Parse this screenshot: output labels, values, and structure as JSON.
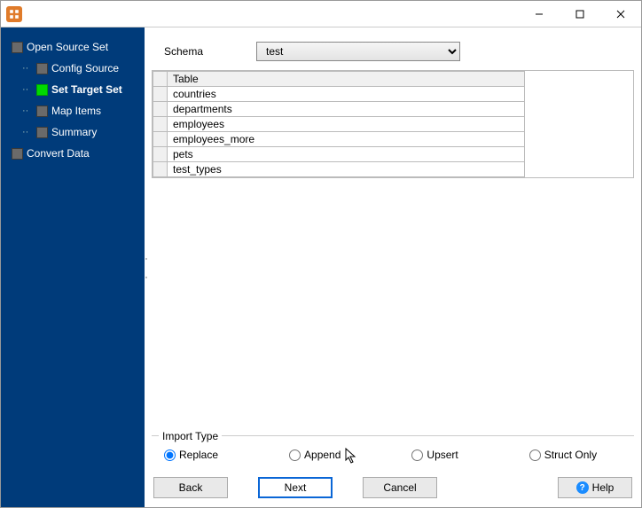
{
  "sidebar": {
    "items": [
      {
        "label": "Open Source Set",
        "depth": 0,
        "active": false
      },
      {
        "label": "Config Source",
        "depth": 1,
        "active": false
      },
      {
        "label": "Set Target Set",
        "depth": 1,
        "active": true
      },
      {
        "label": "Map Items",
        "depth": 1,
        "active": false
      },
      {
        "label": "Summary",
        "depth": 1,
        "active": false
      },
      {
        "label": "Convert Data",
        "depth": 0,
        "active": false
      }
    ]
  },
  "schema": {
    "label": "Schema",
    "value": "test"
  },
  "table": {
    "header": "Table",
    "rows": [
      "countries",
      "departments",
      "employees",
      "employees_more",
      "pets",
      "test_types"
    ]
  },
  "import_type": {
    "legend": "Import Type",
    "options": [
      {
        "label": "Replace",
        "checked": true
      },
      {
        "label": "Append",
        "checked": false
      },
      {
        "label": "Upsert",
        "checked": false
      },
      {
        "label": "Struct Only",
        "checked": false
      }
    ]
  },
  "buttons": {
    "back": "Back",
    "next": "Next",
    "cancel": "Cancel",
    "help": "Help"
  }
}
